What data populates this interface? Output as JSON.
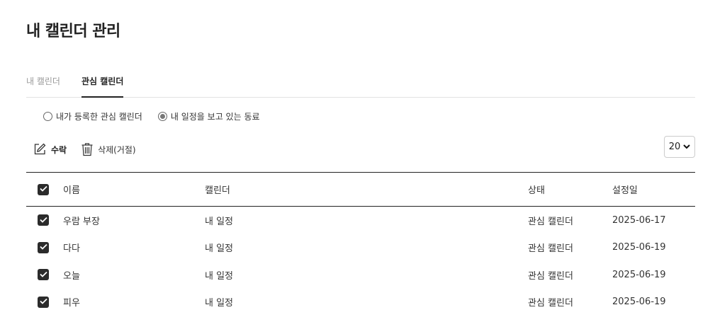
{
  "page": {
    "title": "내 캘린더 관리"
  },
  "tabs": [
    {
      "label": "내 캘린더",
      "active": false
    },
    {
      "label": "관심 캘린더",
      "active": true
    }
  ],
  "filter": {
    "options": [
      {
        "label": "내가 등록한 관심 캘린더",
        "checked": false
      },
      {
        "label": "내 일정을 보고 있는 동료",
        "checked": true
      }
    ]
  },
  "toolbar": {
    "accept_label": "수락",
    "delete_label": "삭제(거절)",
    "page_size": "20"
  },
  "table": {
    "columns": [
      "이름",
      "캘린더",
      "상태",
      "설정일"
    ],
    "rows": [
      {
        "name": "우람 부장",
        "calendar": "내 일정",
        "state": "관심 캘린더",
        "date": "2025-06-17",
        "checked": true
      },
      {
        "name": "다다",
        "calendar": "내 일정",
        "state": "관심 캘린더",
        "date": "2025-06-19",
        "checked": true
      },
      {
        "name": "오늘",
        "calendar": "내 일정",
        "state": "관심 캘린더",
        "date": "2025-06-19",
        "checked": true
      },
      {
        "name": "피우",
        "calendar": "내 일정",
        "state": "관심 캘린더",
        "date": "2025-06-19",
        "checked": true
      }
    ]
  },
  "colors": {
    "accent": "#222222",
    "checkbox": "#2b2b2b",
    "muted": "#9a9a9a"
  },
  "icons": {
    "accept": "edit-icon",
    "delete": "trash-icon",
    "check": "check-icon",
    "select": "chevron-down-icon"
  }
}
